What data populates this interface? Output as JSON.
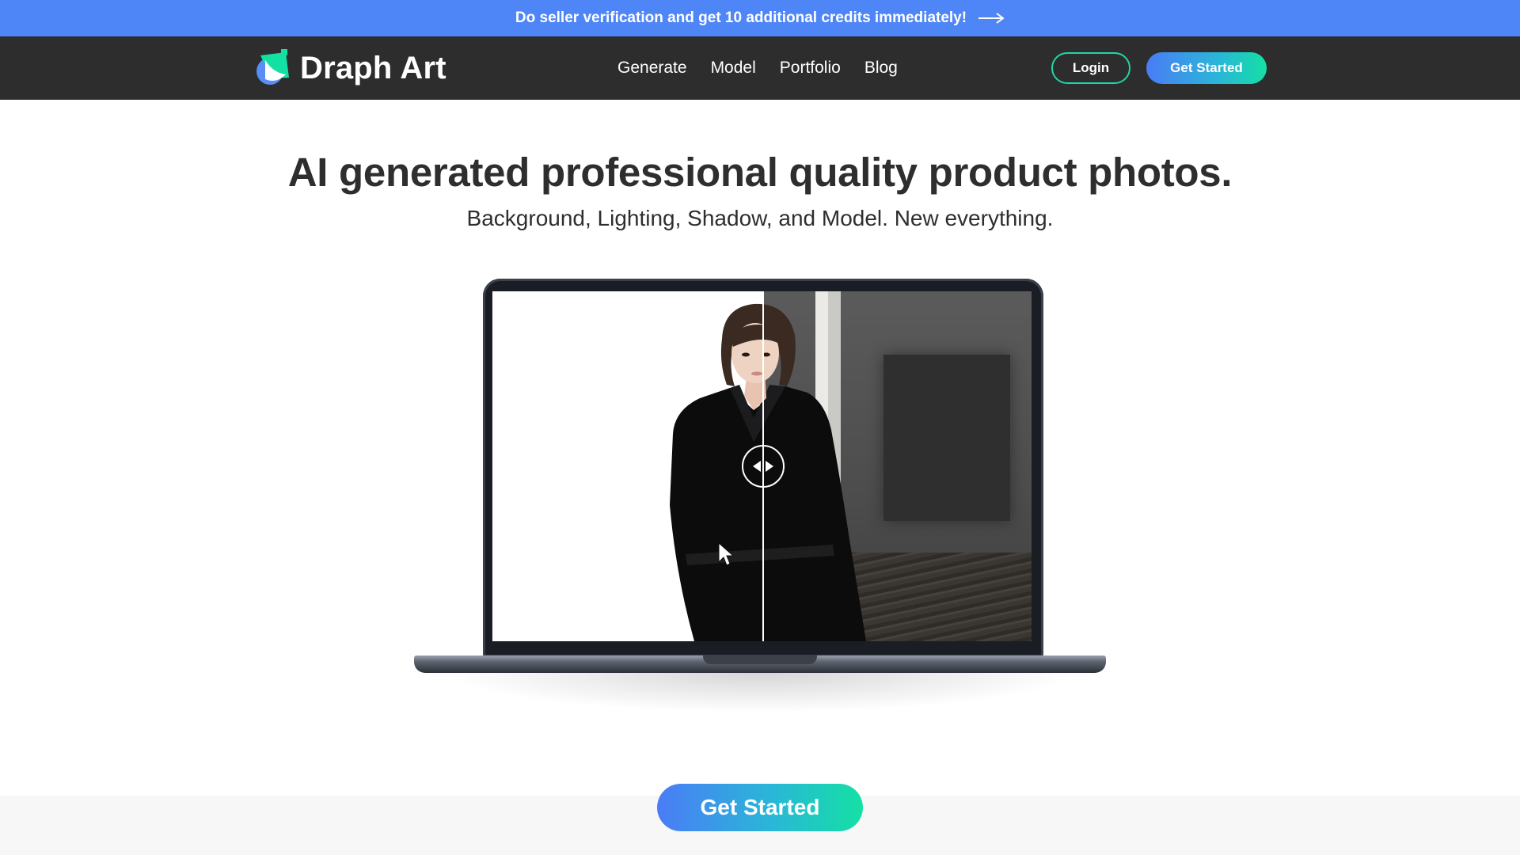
{
  "promo": {
    "text": "Do seller verification and get 10 additional credits immediately!",
    "icon": "long-arrow-right-icon"
  },
  "nav": {
    "brand": "Draph Art",
    "links": [
      "Generate",
      "Model",
      "Portfolio",
      "Blog"
    ],
    "login_label": "Login",
    "get_started_label": "Get Started"
  },
  "hero": {
    "title": "AI generated professional quality product photos.",
    "subtitle": "Background, Lighting, Shadow, and Model. New everything."
  },
  "showcase": {
    "handle_icon": "left-right-arrows-icon",
    "before_background": "white",
    "after_background": "gray room"
  },
  "cta": {
    "label": "Get Started"
  },
  "colors": {
    "promo_bar": "#4f86f7",
    "navbar": "#2d2d2d",
    "gradient_start": "#4a7cf6",
    "gradient_end": "#14e0a4",
    "login_border": "#1fd6a6"
  }
}
